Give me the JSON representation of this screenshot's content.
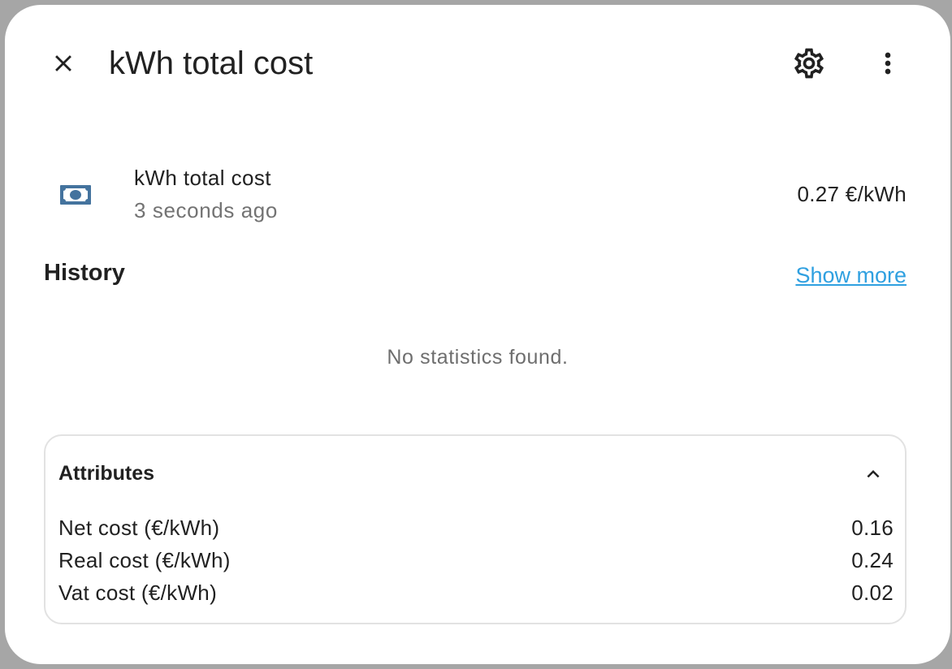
{
  "dialog": {
    "title": "kWh total cost",
    "close_icon": "close-icon",
    "settings_icon": "gear-icon",
    "more_icon": "dots-vertical-icon"
  },
  "entity": {
    "icon": "cash-icon",
    "name": "kWh total cost",
    "last_changed": "3 seconds ago",
    "state": "0.27 €/kWh"
  },
  "history": {
    "title": "History",
    "show_more": "Show more",
    "empty_message": "No statistics found."
  },
  "attributes": {
    "title": "Attributes",
    "expanded": true,
    "toggle_icon": "chevron-up-icon",
    "items": [
      {
        "name": "Net cost (€/kWh)",
        "value": "0.16"
      },
      {
        "name": "Real cost (€/kWh)",
        "value": "0.24"
      },
      {
        "name": "Vat cost (€/kWh)",
        "value": "0.02"
      }
    ]
  },
  "colors": {
    "accent_link": "#2fa0e0",
    "icon_blue": "#44739e",
    "text_primary": "#212121",
    "text_secondary": "#737373"
  }
}
